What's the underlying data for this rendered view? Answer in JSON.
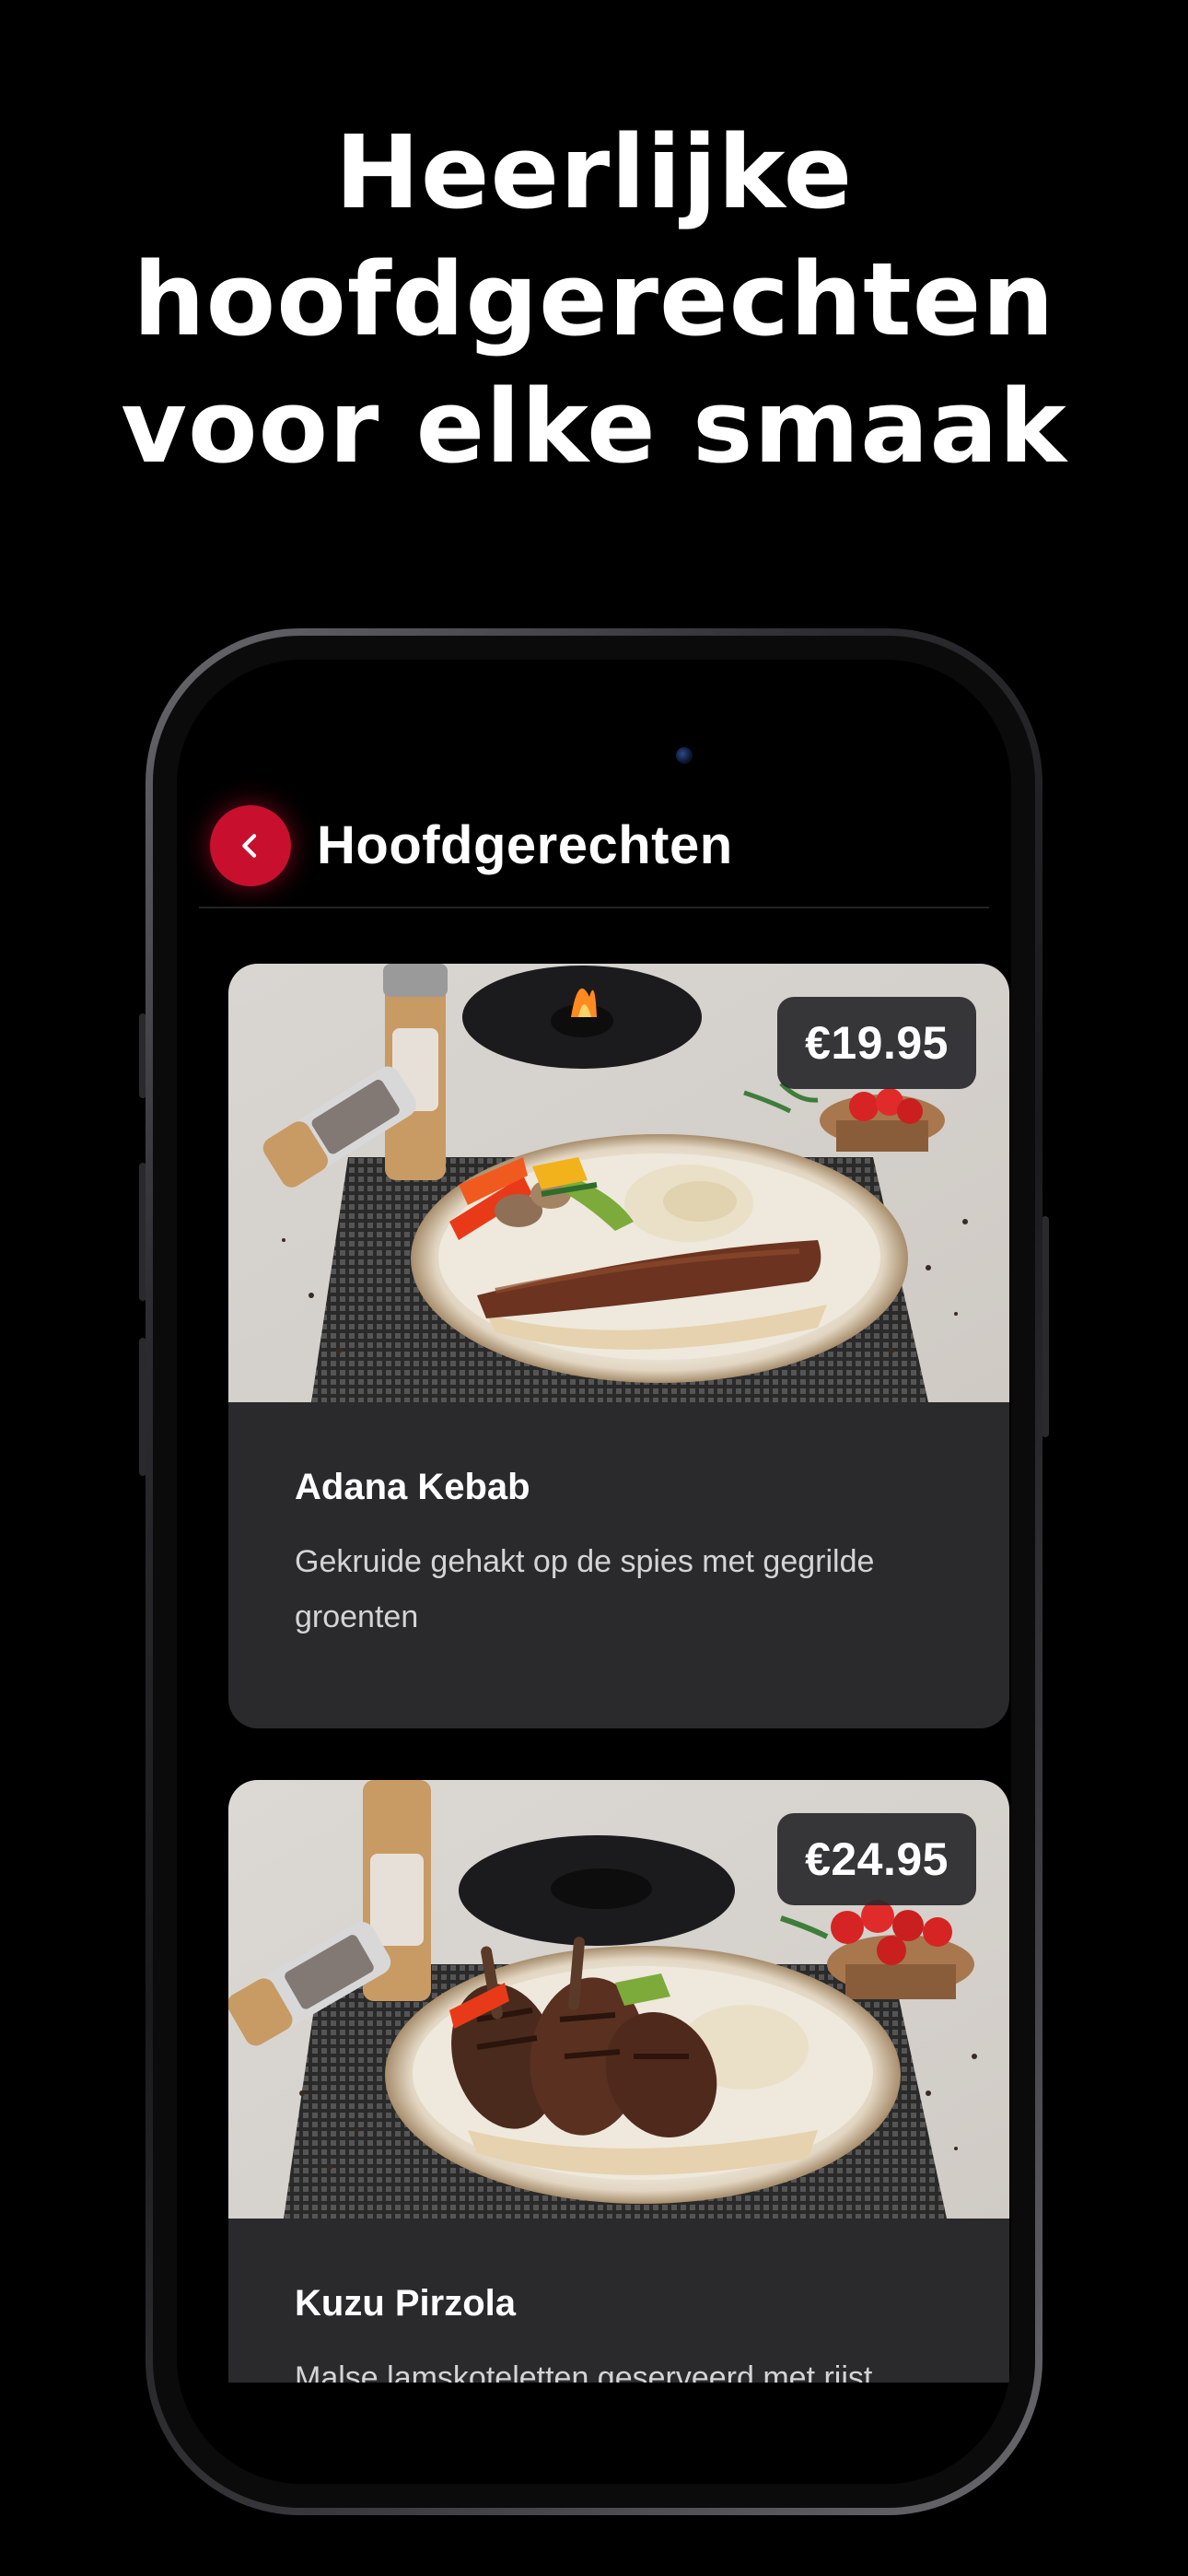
{
  "headline": {
    "line1": "Heerlijke",
    "line2": "hoofdgerechten",
    "line3": "voor elke smaak"
  },
  "appbar": {
    "title": "Hoofdgerechten",
    "back_icon": "chevron-left-icon"
  },
  "colors": {
    "accent": "#c8102e",
    "card_bg": "#2a2a2d",
    "background": "#000000"
  },
  "dishes": [
    {
      "name": "Adana Kebab",
      "description": "Gekruide gehakt op de spies met gegrilde groenten",
      "price": "€19.95"
    },
    {
      "name": "Kuzu Pirzola",
      "description": "Malse lamskoteletten geserveerd met rijst",
      "price": "€24.95"
    }
  ]
}
